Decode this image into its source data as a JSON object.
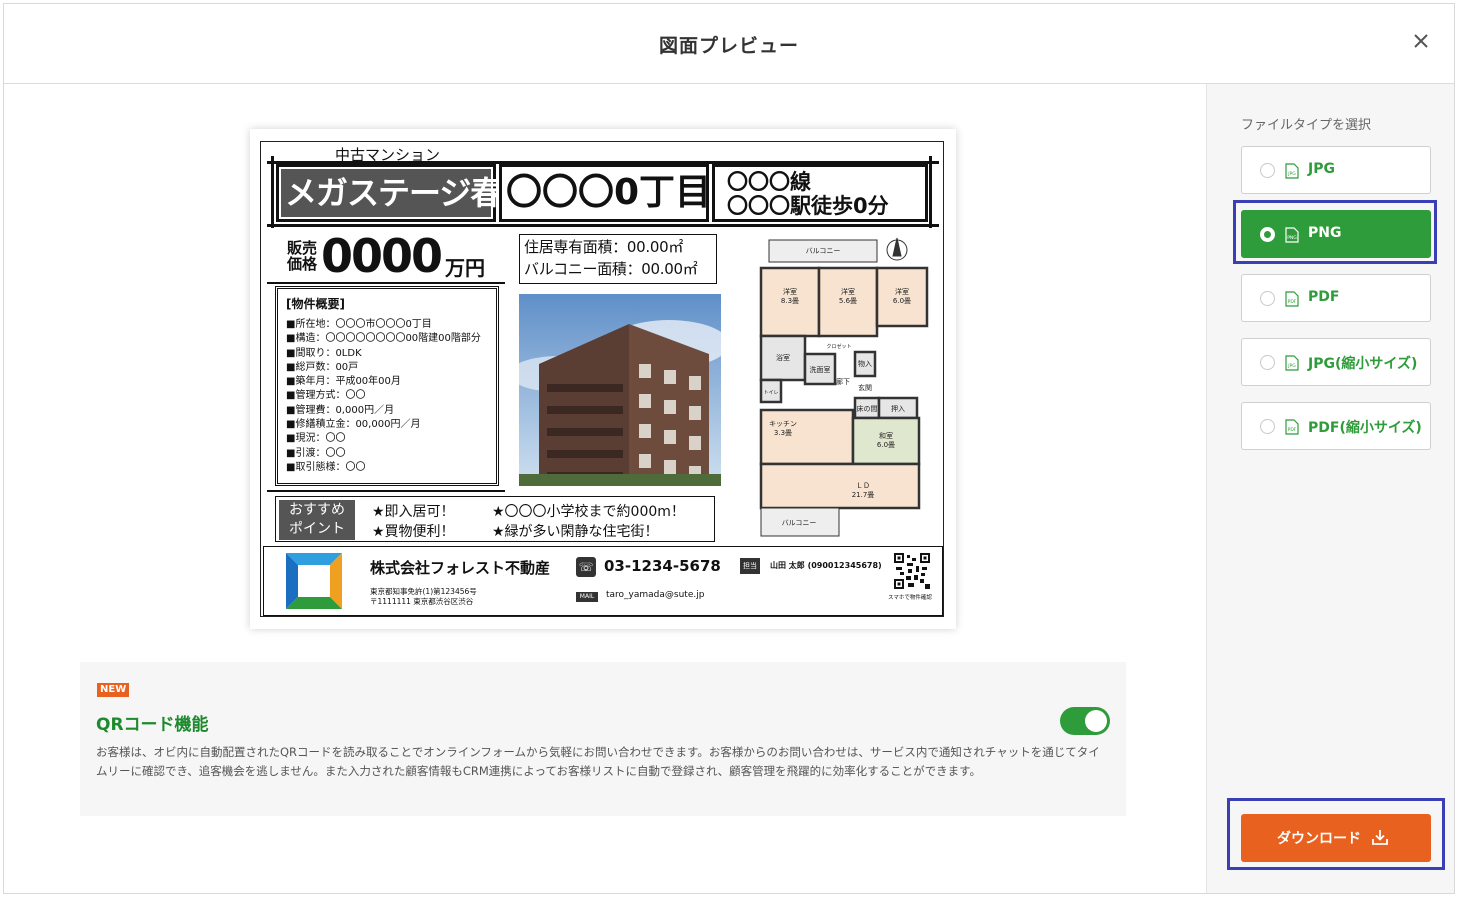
{
  "modal": {
    "title": "図面プレビュー",
    "close_icon": "close-icon"
  },
  "flyer": {
    "type_label": "中古マンション",
    "property_name": "メガステージ春日",
    "address": "〇〇〇0丁目",
    "station_line1": "〇〇〇線",
    "station_line2": "〇〇〇駅徒歩0分",
    "price_label_1": "販売",
    "price_label_2": "価格",
    "price": "0000",
    "price_unit": "万円",
    "area_1": "住居専有面積：00.00㎡",
    "area_2": "バルコニー面積：00.00㎡",
    "overview_heading": "[物件概要]",
    "overview_items": [
      "■所在地：〇〇〇市〇〇〇0丁目",
      "■構造：〇〇〇〇〇〇〇〇00階建00階部分",
      "■間取り：0LDK",
      "■総戸数：00戸",
      "■築年月：平成00年00月",
      "■管理方式：〇〇",
      "■管理費：0,000円／月",
      "■修繕積立金：00,000円／月",
      "■現況：〇〇",
      "■引渡：〇〇",
      "■取引態様：〇〇"
    ],
    "recommend_label_1": "おすすめ",
    "recommend_label_2": "ポイント",
    "recommend_points": [
      "★即入居可！",
      "★〇〇〇小学校まで約000m！",
      "★買物便利！",
      "★緑が多い閑静な住宅街！"
    ],
    "floorplan": {
      "balcony_top": "バルコニー",
      "room1": "洋室",
      "room1_size": "8.3畳",
      "room2": "洋室",
      "room2_size": "5.6畳",
      "room3": "洋室",
      "room3_size": "6.0畳",
      "closet": "クロゼット",
      "bath": "浴室",
      "wash": "洗面室",
      "toilet": "トイレ",
      "storage": "物入",
      "hall": "廊下",
      "entrance": "玄関",
      "tokonoma": "床の間",
      "oshiire": "押入",
      "kitchen": "キッチン",
      "kitchen_size": "3.3畳",
      "washitsu": "和室",
      "washitsu_size": "6.0畳",
      "ld": "ＬＤ",
      "ld_size": "21.7畳",
      "balcony_bottom": "バルコニー"
    },
    "company": "株式会社フォレスト不動産",
    "license_1": "東京都知事免許(1)第123456号",
    "license_2": "〒1111111 東京都渋谷区渋谷",
    "phone": "03-1234-5678",
    "staff_label": "担当",
    "staff": "山田 太郎 (090012345678)",
    "mail_label": "MAIL",
    "email": "taro_yamada@sute.jp",
    "qr_caption": "スマホで物件確認"
  },
  "feature": {
    "badge": "NEW",
    "title": "QRコード機能",
    "description": "お客様は、オビ内に自動配置されたQRコードを読み取ることでオンラインフォームから気軽にお問い合わせできます。お客様からのお問い合わせは、サービス内で通知されチャットを通じてタイムリーに確認でき、追客機会を逃しません。また入力された顧客情報もCRM連携によってお客様リストに自動で登録され、顧客管理を飛躍的に効率化することができます。",
    "toggle_on": true
  },
  "sidebar": {
    "label": "ファイルタイプを選択",
    "options": [
      {
        "label": "JPG",
        "icon": "jpg-file-icon",
        "icon_text": "JPG",
        "selected": false
      },
      {
        "label": "PNG",
        "icon": "png-file-icon",
        "icon_text": "PNG",
        "selected": true
      },
      {
        "label": "PDF",
        "icon": "pdf-file-icon",
        "icon_text": "PDF",
        "selected": false
      },
      {
        "label": "JPG(縮小サイズ)",
        "icon": "jpg-file-icon",
        "icon_text": "JPG",
        "selected": false
      },
      {
        "label": "PDF(縮小サイズ)",
        "icon": "pdf-file-icon",
        "icon_text": "PDF",
        "selected": false
      }
    ],
    "download_label": "ダウンロード",
    "download_icon": "download-icon"
  },
  "colors": {
    "accent_green": "#2f9c3b",
    "accent_orange": "#e8611e",
    "highlight": "#3b3fb6"
  }
}
